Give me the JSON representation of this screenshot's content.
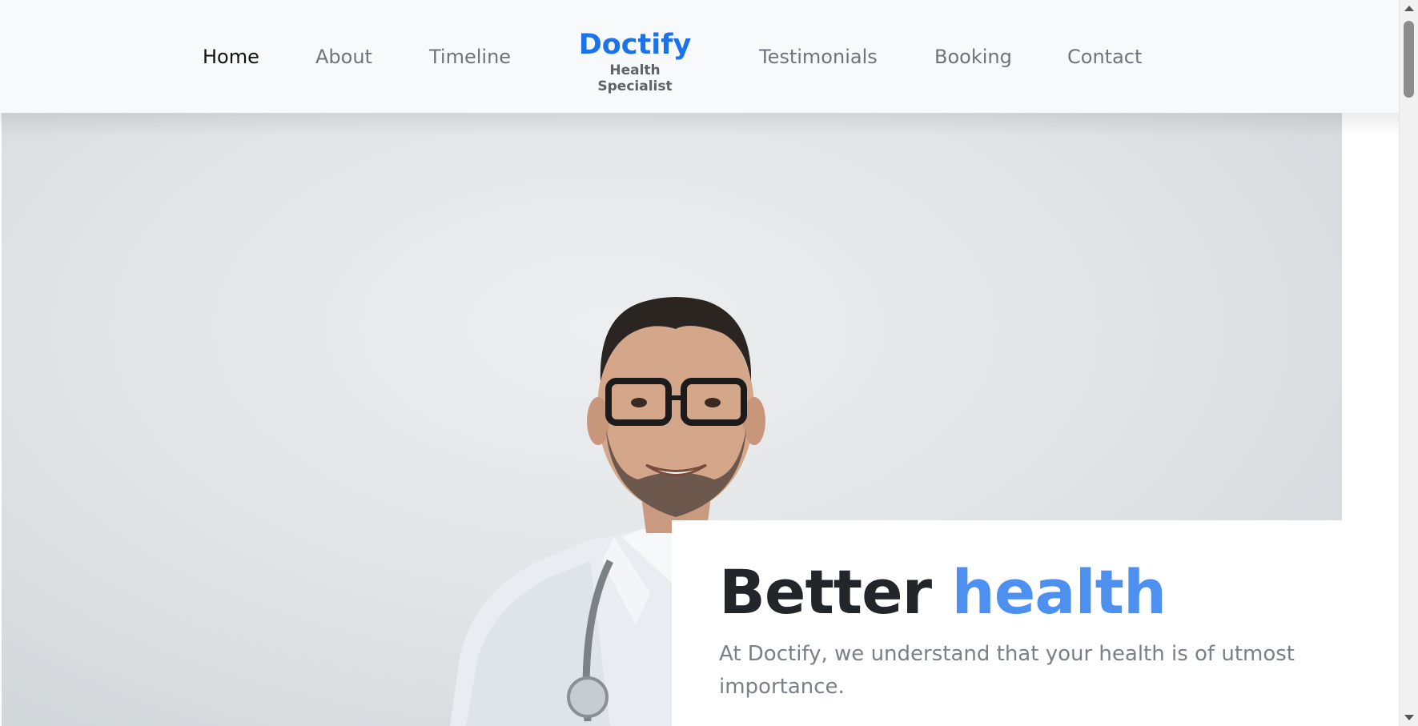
{
  "nav": {
    "left": [
      "Home",
      "About",
      "Timeline"
    ],
    "right": [
      "Testimonials",
      "Booking",
      "Contact"
    ],
    "active": "Home"
  },
  "brand": {
    "name": "Doctify",
    "tagline": "Health Specialist"
  },
  "hero": {
    "title_part1": "Better",
    "title_part2": "health",
    "subtitle": "At Doctify, we understand that your health is of utmost importance.",
    "image": "smiling-doctor-with-glasses-and-stethoscope"
  },
  "colors": {
    "brand": "#1a73e8",
    "accent": "#4d90f0",
    "nav_text": "#6c757d",
    "heading": "#22262b"
  }
}
